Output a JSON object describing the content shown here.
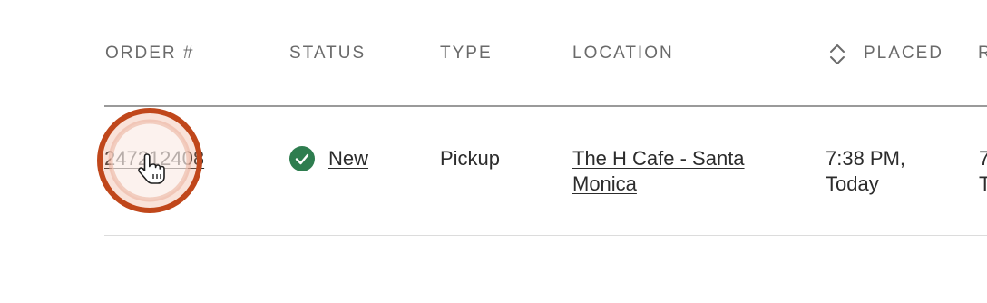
{
  "columns": {
    "order": "ORDER #",
    "status": "STATUS",
    "type": "TYPE",
    "location": "LOCATION",
    "placed": "PLACED",
    "next_partial": "R"
  },
  "row": {
    "order_number": "247212408",
    "status": "New",
    "type": "Pickup",
    "location_line1": "The H Cafe - Santa",
    "location_line2": "Monica",
    "placed_line1": "7:38 PM,",
    "placed_line2": "Today",
    "next_line1_partial": "7",
    "next_line2_partial": "T"
  },
  "colors": {
    "status_new": "#2e7d4f",
    "highlight_ring": "#c0471b",
    "header_text": "#6a6a6a"
  },
  "icons": {
    "sort": "sort-updown-icon",
    "status": "check-circle-icon",
    "cursor": "hand-pointer-icon"
  }
}
